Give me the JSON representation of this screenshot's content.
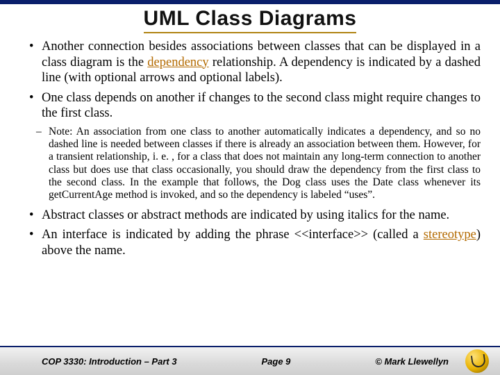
{
  "title": "UML Class Diagrams",
  "bullets": {
    "b1_pre": "Another connection besides associations between classes that can be displayed in a class diagram is the ",
    "b1_kw": "dependency",
    "b1_post": " relationship.  A dependency is indicated by a dashed line (with optional arrows and optional labels).",
    "b2": "One class depends on another if changes to the second class might require changes to the first class.",
    "note": "Note:  An association from one class to another automatically indicates a dependency, and so no dashed line is needed between classes if there is already an association between them.  However, for a transient relationship, i. e. , for a class that does not maintain any long-term connection to another class but does use that class occasionally, you should draw the dependency from the first class to the second class.  In the example that follows, the Dog class uses the Date class whenever its getCurrentAge method is invoked, and so the dependency is labeled “uses”.",
    "b3": "Abstract classes or abstract methods are indicated by using italics for the name.",
    "b4_pre": "An interface is indicated by adding the phrase <<interface>> (called a ",
    "b4_kw": "stereotype",
    "b4_post": ") above the name."
  },
  "footer": {
    "course": "COP 3330: Introduction – Part 3",
    "page": "Page 9",
    "copyright": "© Mark Llewellyn"
  }
}
